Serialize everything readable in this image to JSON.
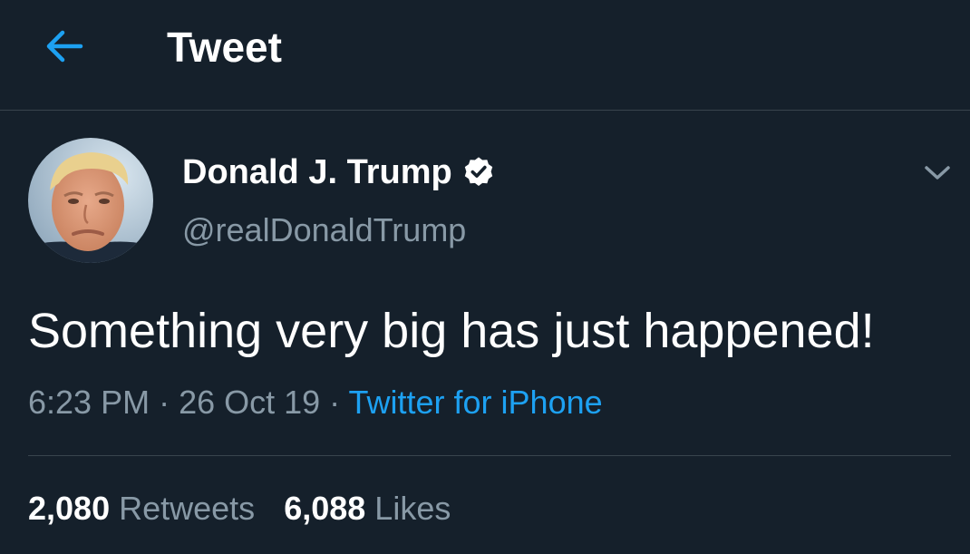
{
  "colors": {
    "background": "#15202b",
    "divider": "#38444d",
    "accent": "#1da1f2",
    "muted": "#8899a6",
    "text": "#ffffff"
  },
  "header": {
    "back_icon": "arrow-left-icon",
    "title": "Tweet"
  },
  "tweet": {
    "author": {
      "display_name": "Donald J. Trump",
      "verified_icon": "verified-badge-icon",
      "handle": "@realDonaldTrump"
    },
    "menu_icon": "chevron-down-icon",
    "text": "Something very big has just happened!",
    "time": "6:23 PM",
    "sep1": " · ",
    "date": "26 Oct 19",
    "sep2": " · ",
    "source": "Twitter for iPhone",
    "stats": {
      "retweets_count": "2,080",
      "retweets_label": "Retweets",
      "likes_count": "6,088",
      "likes_label": "Likes"
    }
  }
}
